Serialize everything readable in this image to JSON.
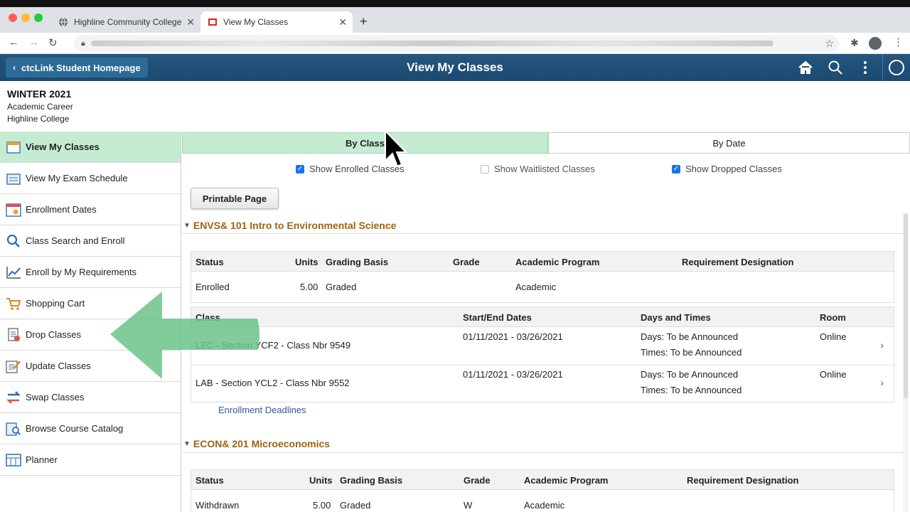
{
  "browser": {
    "tabs": [
      {
        "label": "Highline Community College",
        "icon": "globe-icon"
      },
      {
        "label": "View My Classes",
        "icon": "ctclink-favicon"
      }
    ]
  },
  "header": {
    "back_label": "ctcLink Student Homepage",
    "title": "View My Classes",
    "color": "#1f4e76"
  },
  "term": {
    "name": "WINTER 2021",
    "career": "Academic Career",
    "institution": "Highline College"
  },
  "sidebar": {
    "items": [
      {
        "label": "View My Classes",
        "icon": "calendar-icon"
      },
      {
        "label": "View My Exam Schedule",
        "icon": "schedule-icon"
      },
      {
        "label": "Enrollment Dates",
        "icon": "calendar-date-icon"
      },
      {
        "label": "Class Search and Enroll",
        "icon": "search-icon"
      },
      {
        "label": "Enroll by My Requirements",
        "icon": "chart-icon"
      },
      {
        "label": "Shopping Cart",
        "icon": "cart-icon"
      },
      {
        "label": "Drop Classes",
        "icon": "drop-icon"
      },
      {
        "label": "Update Classes",
        "icon": "edit-icon"
      },
      {
        "label": "Swap Classes",
        "icon": "swap-icon"
      },
      {
        "label": "Browse Course Catalog",
        "icon": "catalog-icon"
      },
      {
        "label": "Planner",
        "icon": "planner-icon"
      }
    ]
  },
  "view_tabs": {
    "by_class": "By Class",
    "by_date": "By Date"
  },
  "filters": {
    "enrolled": "Show Enrolled Classes",
    "waitlisted": "Show Waitlisted Classes",
    "dropped": "Show Dropped Classes"
  },
  "print_label": "Printable Page",
  "courses": [
    {
      "title": "ENVS& 101 Intro to Environmental Science",
      "headers": {
        "status": "Status",
        "units": "Units",
        "grading": "Grading Basis",
        "grade": "Grade",
        "program": "Academic Program",
        "req": "Requirement Designation"
      },
      "row": {
        "status": "Enrolled",
        "units": "5.00",
        "grading": "Graded",
        "grade": "",
        "program": "Academic",
        "req": ""
      },
      "class_headers": {
        "class": "Class",
        "dates": "Start/End Dates",
        "days": "Days and Times",
        "room": "Room"
      },
      "sections": [
        {
          "class": "LEC - Section YCF2 - Class Nbr 9549",
          "dates": "01/11/2021 - 03/26/2021",
          "days": "Days: To be Announced",
          "times": "Times: To be Announced",
          "room": "Online"
        },
        {
          "class": "LAB - Section YCL2 - Class Nbr 9552",
          "dates": "01/11/2021 - 03/26/2021",
          "days": "Days: To be Announced",
          "times": "Times: To be Announced",
          "room": "Online"
        }
      ],
      "link": "Enrollment Deadlines"
    },
    {
      "title": "ECON& 201 Microeconomics",
      "headers": {
        "status": "Status",
        "units": "Units",
        "grading": "Grading Basis",
        "grade": "Grade",
        "program": "Academic Program",
        "req": "Requirement Designation"
      },
      "row": {
        "status": "Withdrawn",
        "units": "5.00",
        "grading": "Graded",
        "grade": "W",
        "program": "Academic",
        "req": ""
      }
    }
  ],
  "colors": {
    "active_green": "#c6ebd3",
    "course_title": "#a1620f",
    "link": "#2f5b9c",
    "arrow": "#6cc38a"
  }
}
